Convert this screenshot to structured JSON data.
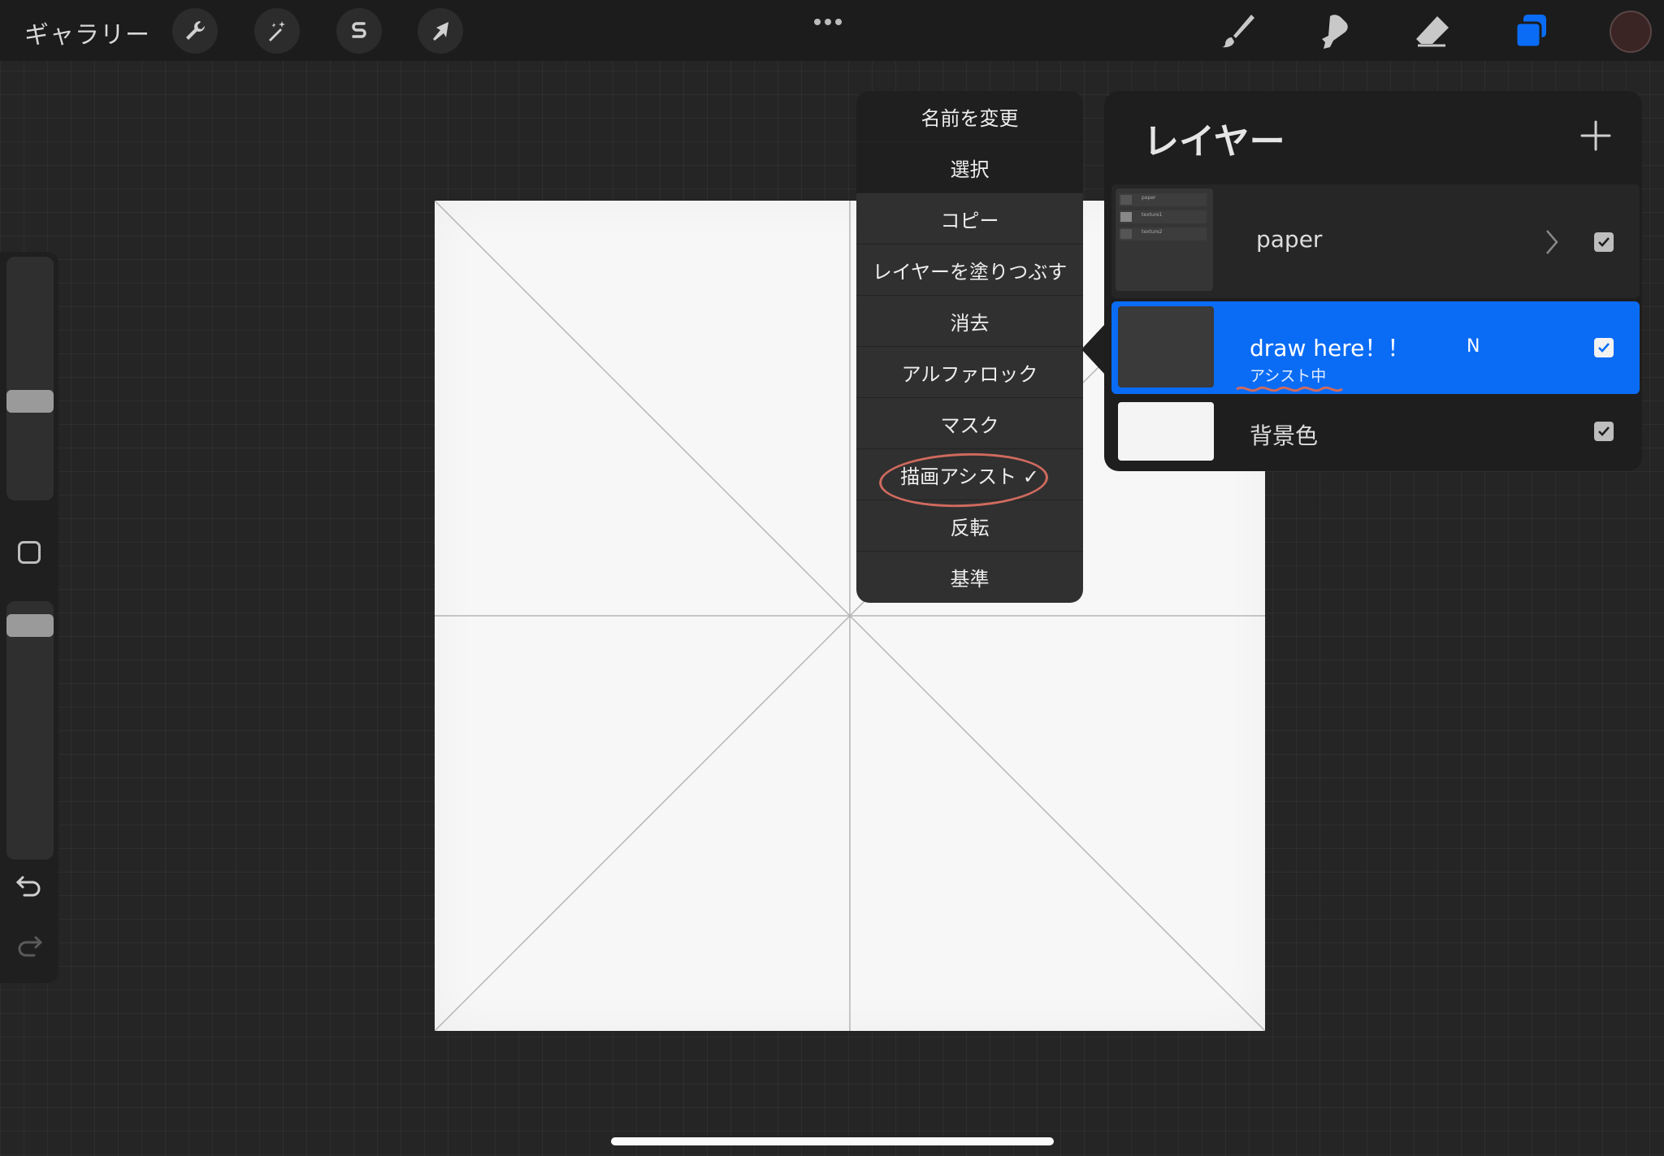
{
  "topbar": {
    "gallery_label": "ギャラリー",
    "left_tools": [
      "wrench-icon",
      "magic-wand-icon",
      "selection-s-icon",
      "transform-arrow-icon"
    ],
    "right_tools": [
      "brush-icon",
      "smudge-icon",
      "eraser-icon",
      "layers-icon"
    ],
    "current_color": "#3a2424",
    "accent": "#0a6cf5"
  },
  "context_menu": {
    "items": [
      "名前を変更",
      "選択",
      "コピー",
      "レイヤーを塗りつぶす",
      "消去",
      "アルファロック",
      "マスク",
      "描画アシスト ✓",
      "反転",
      "基準"
    ]
  },
  "layers": {
    "title": "レイヤー",
    "rows": [
      {
        "name": "paper",
        "kind": "group",
        "visible": true,
        "mini_layers": [
          "paper",
          "texture1",
          "texture2"
        ]
      },
      {
        "name": "draw here！！",
        "sub": "アシスト中",
        "blend": "N",
        "visible": true,
        "selected": true
      },
      {
        "name": "背景色",
        "visible": true
      }
    ]
  }
}
